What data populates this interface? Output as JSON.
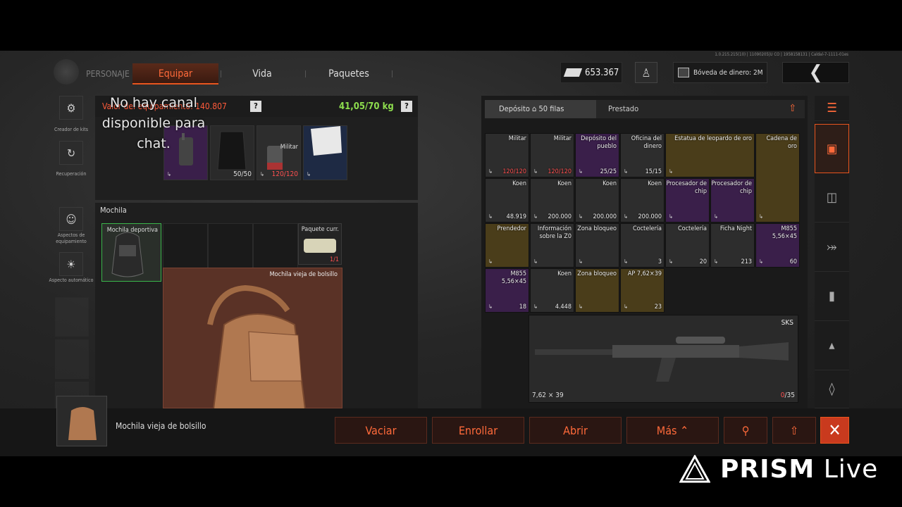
{
  "build_info": "1.0.215.215(10) | 11090205|U CO | 1958158131 | Caldal-7-1111-01es",
  "header": {
    "tabs": [
      {
        "label": "PERSONAJE"
      },
      {
        "label": "Equipar"
      },
      {
        "label": "Vida"
      },
      {
        "label": "Paquetes"
      }
    ],
    "cash": "653.367",
    "vault": "Bóveda de dinero: 2M"
  },
  "sidebar": {
    "items": [
      {
        "label": "Creador de kits",
        "icon": "kit-icon"
      },
      {
        "label": "Recuperación",
        "icon": "recovery-icon"
      },
      {
        "label": "Aspectos de equipamiento",
        "icon": "skin-icon"
      },
      {
        "label": "Aspecto automático",
        "icon": "auto-skin-icon"
      }
    ]
  },
  "chat_overlay": "No hay canal disponible para chat.",
  "equipment": {
    "value_label": "Valor del equipamiento: 140.807",
    "weight": "41,05/70 kg",
    "help": "?",
    "slots": [
      {
        "count": "",
        "color": "#3a1f4a"
      },
      {
        "count": "50/50",
        "color": "#2a2a2a"
      },
      {
        "name": "Militar",
        "count": "120/120",
        "color": "#2d2d2d"
      },
      {
        "count": "",
        "color": "#1e2a44"
      }
    ]
  },
  "backpack": {
    "title": "Mochila",
    "equipped": "Mochila deportiva",
    "package": {
      "name": "Paquete curr.",
      "count": "1/1"
    },
    "opened": "Mochila vieja de bolsillo"
  },
  "depot": {
    "tab_active": "Depósito",
    "rows": "50 filas",
    "tab_other": "Prestado",
    "cells": [
      {
        "name": "Militar",
        "count": "120/120",
        "color": "gray"
      },
      {
        "name": "Militar",
        "count": "120/120",
        "color": "gray"
      },
      {
        "name": "Depósito del pueblo",
        "count": "25/25",
        "color": "purple"
      },
      {
        "name": "Oficina del dinero",
        "count": "15/15",
        "color": "gray"
      },
      {
        "name": "Estatua de leopardo de oro",
        "count": "",
        "color": "gold"
      },
      {
        "name": "Cadena de oro",
        "count": "",
        "color": "gold"
      },
      {
        "name": "Koen",
        "count": "48.919",
        "color": "gray"
      },
      {
        "name": "Koen",
        "count": "200.000",
        "color": "gray"
      },
      {
        "name": "Koen",
        "count": "200.000",
        "color": "gray"
      },
      {
        "name": "Koen",
        "count": "200.000",
        "color": "gray"
      },
      {
        "name": "Procesador de chip",
        "count": "",
        "color": "purple"
      },
      {
        "name": "Procesador de chip",
        "count": "",
        "color": "purple"
      },
      {
        "name": "Prendedor",
        "count": "",
        "color": "gold"
      },
      {
        "name": "Información sobre la Z0",
        "count": "",
        "color": "gray"
      },
      {
        "name": "Zona bloqueo",
        "count": "",
        "color": "gray"
      },
      {
        "name": "Coctelería",
        "count": "3",
        "color": "gray"
      },
      {
        "name": "Coctelería",
        "count": "20",
        "color": "gray"
      },
      {
        "name": "Ficha Night",
        "count": "213",
        "color": "gray"
      },
      {
        "name": "M855 5,56×45",
        "count": "60",
        "color": "purple"
      },
      {
        "name": "M855 5,56×45",
        "count": "18",
        "color": "purple"
      },
      {
        "name": "Koen",
        "count": "4.448",
        "color": "gray"
      },
      {
        "name": "Zona bloqueo",
        "count": "",
        "color": "gold"
      },
      {
        "name": "AP 7,62×39",
        "count": "23",
        "color": "gold"
      }
    ],
    "weapon": {
      "name": "SKS",
      "caliber": "7,62 × 39",
      "ammo_loaded": "0",
      "ammo_max": "/35"
    }
  },
  "footer": {
    "selected_item": "Mochila vieja de bolsillo",
    "buttons": [
      {
        "label": "Vaciar"
      },
      {
        "label": "Enrollar"
      },
      {
        "label": "Abrir"
      },
      {
        "label": "Más"
      }
    ]
  },
  "watermark": {
    "brand": "PRISM",
    "suffix": "Live"
  },
  "colors": {
    "accent": "#e8551e",
    "value_red": "#ff5a3a",
    "weight_green": "#8ede4e"
  }
}
